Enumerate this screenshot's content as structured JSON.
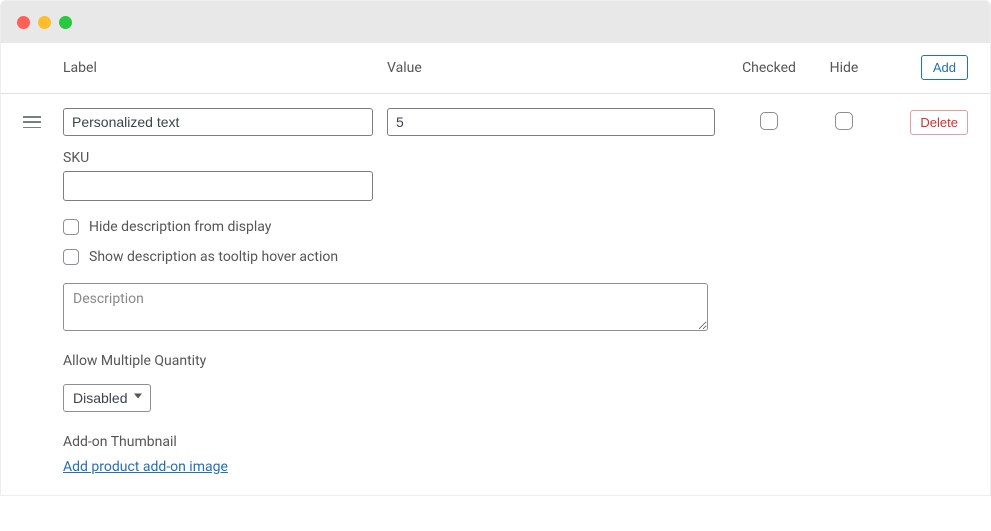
{
  "headers": {
    "label": "Label",
    "value": "Value",
    "checked": "Checked",
    "hide": "Hide"
  },
  "buttons": {
    "add": "Add",
    "delete": "Delete"
  },
  "row": {
    "label_value": "Personalized text",
    "value_value": "5",
    "checked": false,
    "hide": false
  },
  "sku": {
    "label": "SKU",
    "value": ""
  },
  "options": {
    "hide_desc": "Hide description from display",
    "tooltip_desc": "Show description as tooltip hover action"
  },
  "description": {
    "placeholder": "Description",
    "value": ""
  },
  "multiple_qty": {
    "label": "Allow Multiple Quantity",
    "selected": "Disabled"
  },
  "thumbnail": {
    "label": "Add-on Thumbnail",
    "link": "Add product add-on image"
  }
}
